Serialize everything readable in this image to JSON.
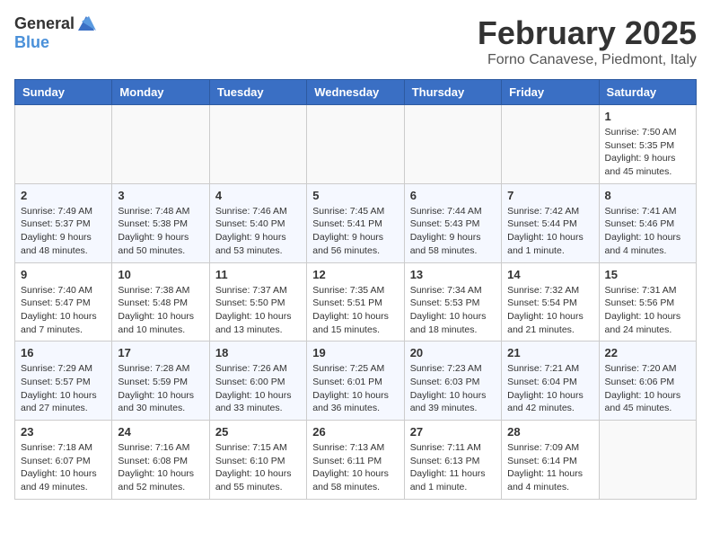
{
  "header": {
    "logo_general": "General",
    "logo_blue": "Blue",
    "month_title": "February 2025",
    "location": "Forno Canavese, Piedmont, Italy"
  },
  "weekdays": [
    "Sunday",
    "Monday",
    "Tuesday",
    "Wednesday",
    "Thursday",
    "Friday",
    "Saturday"
  ],
  "weeks": [
    [
      {
        "day": "",
        "info": ""
      },
      {
        "day": "",
        "info": ""
      },
      {
        "day": "",
        "info": ""
      },
      {
        "day": "",
        "info": ""
      },
      {
        "day": "",
        "info": ""
      },
      {
        "day": "",
        "info": ""
      },
      {
        "day": "1",
        "info": "Sunrise: 7:50 AM\nSunset: 5:35 PM\nDaylight: 9 hours and 45 minutes."
      }
    ],
    [
      {
        "day": "2",
        "info": "Sunrise: 7:49 AM\nSunset: 5:37 PM\nDaylight: 9 hours and 48 minutes."
      },
      {
        "day": "3",
        "info": "Sunrise: 7:48 AM\nSunset: 5:38 PM\nDaylight: 9 hours and 50 minutes."
      },
      {
        "day": "4",
        "info": "Sunrise: 7:46 AM\nSunset: 5:40 PM\nDaylight: 9 hours and 53 minutes."
      },
      {
        "day": "5",
        "info": "Sunrise: 7:45 AM\nSunset: 5:41 PM\nDaylight: 9 hours and 56 minutes."
      },
      {
        "day": "6",
        "info": "Sunrise: 7:44 AM\nSunset: 5:43 PM\nDaylight: 9 hours and 58 minutes."
      },
      {
        "day": "7",
        "info": "Sunrise: 7:42 AM\nSunset: 5:44 PM\nDaylight: 10 hours and 1 minute."
      },
      {
        "day": "8",
        "info": "Sunrise: 7:41 AM\nSunset: 5:46 PM\nDaylight: 10 hours and 4 minutes."
      }
    ],
    [
      {
        "day": "9",
        "info": "Sunrise: 7:40 AM\nSunset: 5:47 PM\nDaylight: 10 hours and 7 minutes."
      },
      {
        "day": "10",
        "info": "Sunrise: 7:38 AM\nSunset: 5:48 PM\nDaylight: 10 hours and 10 minutes."
      },
      {
        "day": "11",
        "info": "Sunrise: 7:37 AM\nSunset: 5:50 PM\nDaylight: 10 hours and 13 minutes."
      },
      {
        "day": "12",
        "info": "Sunrise: 7:35 AM\nSunset: 5:51 PM\nDaylight: 10 hours and 15 minutes."
      },
      {
        "day": "13",
        "info": "Sunrise: 7:34 AM\nSunset: 5:53 PM\nDaylight: 10 hours and 18 minutes."
      },
      {
        "day": "14",
        "info": "Sunrise: 7:32 AM\nSunset: 5:54 PM\nDaylight: 10 hours and 21 minutes."
      },
      {
        "day": "15",
        "info": "Sunrise: 7:31 AM\nSunset: 5:56 PM\nDaylight: 10 hours and 24 minutes."
      }
    ],
    [
      {
        "day": "16",
        "info": "Sunrise: 7:29 AM\nSunset: 5:57 PM\nDaylight: 10 hours and 27 minutes."
      },
      {
        "day": "17",
        "info": "Sunrise: 7:28 AM\nSunset: 5:59 PM\nDaylight: 10 hours and 30 minutes."
      },
      {
        "day": "18",
        "info": "Sunrise: 7:26 AM\nSunset: 6:00 PM\nDaylight: 10 hours and 33 minutes."
      },
      {
        "day": "19",
        "info": "Sunrise: 7:25 AM\nSunset: 6:01 PM\nDaylight: 10 hours and 36 minutes."
      },
      {
        "day": "20",
        "info": "Sunrise: 7:23 AM\nSunset: 6:03 PM\nDaylight: 10 hours and 39 minutes."
      },
      {
        "day": "21",
        "info": "Sunrise: 7:21 AM\nSunset: 6:04 PM\nDaylight: 10 hours and 42 minutes."
      },
      {
        "day": "22",
        "info": "Sunrise: 7:20 AM\nSunset: 6:06 PM\nDaylight: 10 hours and 45 minutes."
      }
    ],
    [
      {
        "day": "23",
        "info": "Sunrise: 7:18 AM\nSunset: 6:07 PM\nDaylight: 10 hours and 49 minutes."
      },
      {
        "day": "24",
        "info": "Sunrise: 7:16 AM\nSunset: 6:08 PM\nDaylight: 10 hours and 52 minutes."
      },
      {
        "day": "25",
        "info": "Sunrise: 7:15 AM\nSunset: 6:10 PM\nDaylight: 10 hours and 55 minutes."
      },
      {
        "day": "26",
        "info": "Sunrise: 7:13 AM\nSunset: 6:11 PM\nDaylight: 10 hours and 58 minutes."
      },
      {
        "day": "27",
        "info": "Sunrise: 7:11 AM\nSunset: 6:13 PM\nDaylight: 11 hours and 1 minute."
      },
      {
        "day": "28",
        "info": "Sunrise: 7:09 AM\nSunset: 6:14 PM\nDaylight: 11 hours and 4 minutes."
      },
      {
        "day": "",
        "info": ""
      }
    ]
  ]
}
